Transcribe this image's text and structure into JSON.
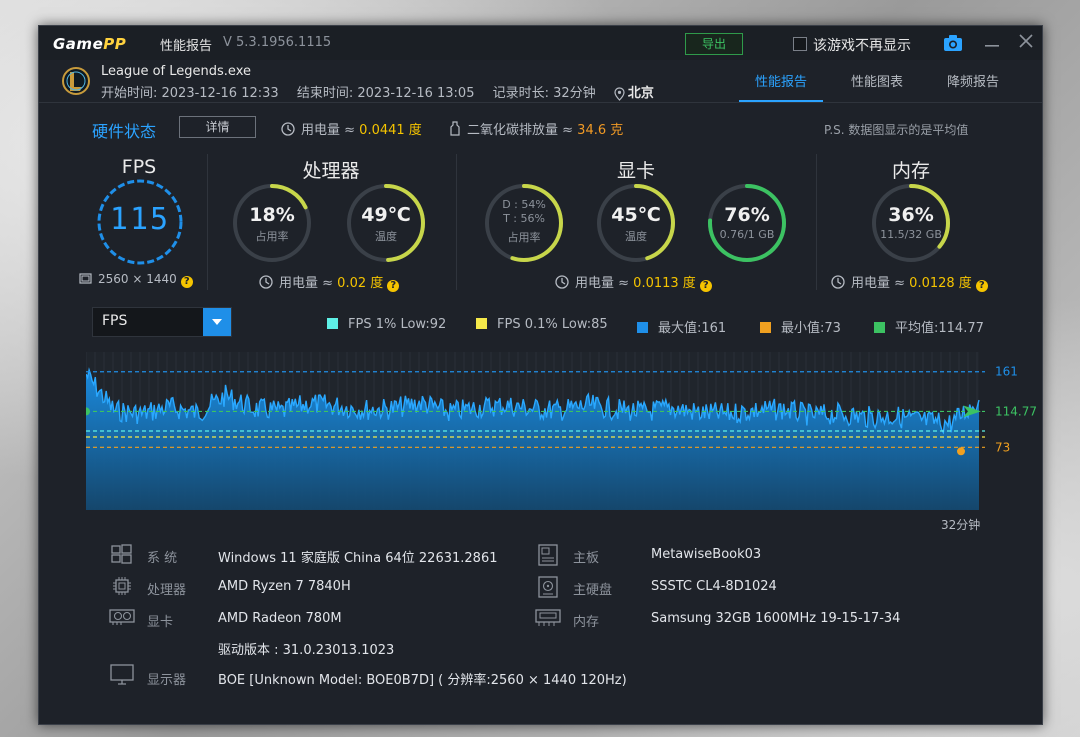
{
  "app": {
    "logo_main": "Game",
    "logo_accent": "PP",
    "title": "性能报告",
    "version": "V 5.3.1956.1115",
    "export_label": "导出",
    "no_show_label": "该游戏不再显示"
  },
  "session": {
    "game": "League of Legends.exe",
    "start": "开始时间: 2023-12-16 12:33",
    "end": "结束时间: 2023-12-16 13:05",
    "duration": "记录时长: 32分钟",
    "location": "北京"
  },
  "tabs": [
    {
      "label": "性能报告",
      "active": true
    },
    {
      "label": "性能图表",
      "active": false
    },
    {
      "label": "降频报告",
      "active": false
    }
  ],
  "hardware": {
    "title": "硬件状态",
    "detail_label": "详情",
    "power_label": "用电量 ≈",
    "power_value": "0.0441 度",
    "co2_label": "二氧化碳排放量 ≈",
    "co2_value": "34.6 克",
    "note": "P.S. 数据图显示的是平均值"
  },
  "fps": {
    "title": "FPS",
    "value": "115",
    "resolution": "2560 × 1440"
  },
  "cpu": {
    "title": "处理器",
    "usage_value": "18%",
    "usage_label": "占用率",
    "usage_frac": 0.18,
    "temp_value": "49℃",
    "temp_label": "温度",
    "temp_frac": 0.49,
    "power_label": "用电量 ≈",
    "power_value": "0.02 度"
  },
  "gpu": {
    "title": "显卡",
    "d_line": "D : 54%",
    "t_line": "T : 56%",
    "usage_label": "占用率",
    "usage_frac": 0.55,
    "temp_value": "45℃",
    "temp_label": "温度",
    "temp_frac": 0.45,
    "mem_value": "76%",
    "mem_label": "0.76/1 GB",
    "mem_frac": 0.76,
    "power_label": "用电量 ≈",
    "power_value": "0.0113 度"
  },
  "memory": {
    "title": "内存",
    "usage_value": "36%",
    "usage_label": "11.5/32 GB",
    "usage_frac": 0.36,
    "power_label": "用电量 ≈",
    "power_value": "0.0128 度"
  },
  "metric_select": {
    "value": "FPS"
  },
  "legend": [
    {
      "label": "FPS 1% Low:92",
      "color": "#5ef0e6"
    },
    {
      "label": "FPS 0.1% Low:85",
      "color": "#f5e94a"
    },
    {
      "label": "最大值:161",
      "color": "#1f8fe8"
    },
    {
      "label": "最小值:73",
      "color": "#f0a020"
    },
    {
      "label": "平均值:114.77",
      "color": "#3cc262"
    }
  ],
  "chart_data": {
    "type": "area",
    "metric": "FPS",
    "xlabel": "32分钟",
    "ylim": [
      0,
      170
    ],
    "lines": {
      "max": 161,
      "avg": 114.77,
      "min": 73,
      "low1": 92,
      "low01": 85
    },
    "marker_labels": {
      "max": "161",
      "avg": "114.77",
      "min": "73"
    },
    "x_minutes": [
      0,
      1,
      2,
      3,
      4,
      5,
      6,
      7,
      8,
      9,
      10,
      11,
      12,
      13,
      14,
      15,
      16,
      17,
      18,
      19,
      20,
      21,
      22,
      23,
      24,
      25,
      26,
      27,
      28,
      29,
      30,
      31,
      32
    ],
    "values": [
      158,
      116,
      112,
      120,
      113,
      133,
      118,
      115,
      124,
      121,
      117,
      118,
      125,
      114,
      119,
      122,
      118,
      116,
      122,
      117,
      114,
      119,
      113,
      112,
      116,
      117,
      110,
      112,
      108,
      109,
      104,
      101,
      128
    ]
  },
  "sysinfo": {
    "left": [
      {
        "label": "系 统",
        "value": "Windows 11 家庭版 China 64位 22631.2861"
      },
      {
        "label": "处理器",
        "value": "AMD Ryzen 7 7840H"
      },
      {
        "label": "显卡",
        "value": "AMD Radeon 780M"
      },
      {
        "label": "",
        "value": "驱动版本 : 31.0.23013.1023"
      },
      {
        "label": "显示器",
        "value": "BOE [Unknown Model: BOE0B7D] ( 分辨率:2560 × 1440 120Hz)"
      }
    ],
    "right": [
      {
        "label": "主板",
        "value": "MetawiseBook03"
      },
      {
        "label": "主硬盘",
        "value": "SSSTC CL4-8D1024"
      },
      {
        "label": "内存",
        "value": "Samsung 32GB 1600MHz 19-15-17-34"
      }
    ]
  }
}
